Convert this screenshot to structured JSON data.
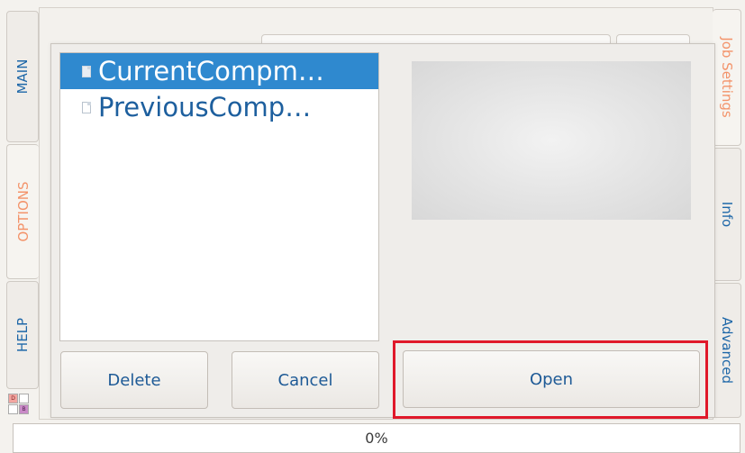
{
  "left_tabs": [
    {
      "label": "MAIN",
      "color": "#1e67a8"
    },
    {
      "label": "OPTIONS",
      "color": "#f3936a"
    },
    {
      "label": "HELP",
      "color": "#1e67a8"
    }
  ],
  "right_tabs": [
    {
      "label": "Job Settings",
      "color": "#f3936a"
    },
    {
      "label": "Info",
      "color": "#1e67a8"
    },
    {
      "label": "Advanced",
      "color": "#1e67a8"
    }
  ],
  "badges": {
    "top_left": "D",
    "bottom_right": "B"
  },
  "file_list": {
    "items": [
      {
        "name": "CurrentCompm…",
        "selected": true,
        "icon": "document-filled-icon"
      },
      {
        "name": "PreviousComp…",
        "selected": false,
        "icon": "document-outline-icon"
      }
    ]
  },
  "dialog": {
    "delete_label": "Delete",
    "cancel_label": "Cancel",
    "open_label": "Open"
  },
  "status": {
    "progress_text": "0%"
  },
  "colors": {
    "accent_blue": "#2f89cf",
    "text_blue": "#1e5a96",
    "highlight_red": "#e0182a"
  }
}
